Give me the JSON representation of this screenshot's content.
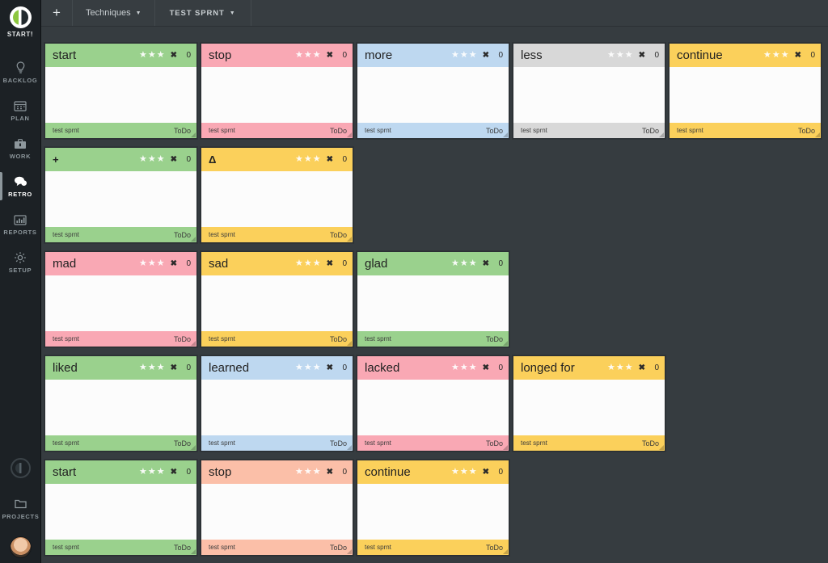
{
  "sidebar": {
    "brand": {
      "label": "START!",
      "icon": "app-logo-icon"
    },
    "items": [
      {
        "label": "BACKLOG",
        "icon": "lightbulb-icon",
        "active": false
      },
      {
        "label": "PLAN",
        "icon": "calendar-icon",
        "active": false
      },
      {
        "label": "WORK",
        "icon": "briefcase-icon",
        "active": false
      },
      {
        "label": "RETRO",
        "icon": "speech-bubble-icon",
        "active": true
      },
      {
        "label": "REPORTS",
        "icon": "bar-chart-icon",
        "active": false
      },
      {
        "label": "SETUP",
        "icon": "gear-icon",
        "active": false
      }
    ],
    "bottom": {
      "projects_label": "PROJECTS",
      "projects_icon": "folder-icon",
      "avatar": "user-avatar"
    }
  },
  "topbar": {
    "add_label": "+",
    "techniques_label": "Techniques",
    "sprint_label": "TEST SPRNT",
    "caret": "▼"
  },
  "card_defaults": {
    "stars": 3,
    "star_glyph": "★",
    "close_glyph": "✖",
    "count": "0",
    "sprint": "test sprnt",
    "status": "ToDo"
  },
  "colors": {
    "background": "#363c40",
    "sidebar": "#1c2125",
    "topbar": "#373d41",
    "green": "#9ad18d",
    "pink": "#f9a8b4",
    "blue": "#bed8f0",
    "gray": "#d8d8d8",
    "yellow": "#fbd05b",
    "salmon": "#fbbfa8",
    "accent_green": "#8cc63f"
  },
  "board": {
    "rows": [
      {
        "name": "start-stop-more-less-continue",
        "cards": [
          {
            "title": "start",
            "color": "green",
            "symbol": false
          },
          {
            "title": "stop",
            "color": "pink",
            "symbol": false
          },
          {
            "title": "more",
            "color": "blue",
            "symbol": false
          },
          {
            "title": "less",
            "color": "gray",
            "symbol": false
          },
          {
            "title": "continue",
            "color": "yellow",
            "symbol": false
          }
        ]
      },
      {
        "name": "plus-delta",
        "cards": [
          {
            "title": "+",
            "color": "green",
            "symbol": true
          },
          {
            "title": "Δ",
            "color": "yellow",
            "symbol": true
          }
        ]
      },
      {
        "name": "mad-sad-glad",
        "cards": [
          {
            "title": "mad",
            "color": "pink",
            "symbol": false
          },
          {
            "title": "sad",
            "color": "yellow",
            "symbol": false
          },
          {
            "title": "glad",
            "color": "green",
            "symbol": false
          }
        ]
      },
      {
        "name": "4l-liked-learned-lacked-longed",
        "cards": [
          {
            "title": "liked",
            "color": "green",
            "symbol": false
          },
          {
            "title": "learned",
            "color": "blue",
            "symbol": false
          },
          {
            "title": "lacked",
            "color": "pink",
            "symbol": false
          },
          {
            "title": "longed for",
            "color": "yellow",
            "symbol": false
          }
        ]
      },
      {
        "name": "start-stop-continue",
        "cards": [
          {
            "title": "start",
            "color": "green",
            "symbol": false
          },
          {
            "title": "stop",
            "color": "salmon",
            "symbol": false
          },
          {
            "title": "continue",
            "color": "yellow",
            "symbol": false
          }
        ]
      }
    ]
  }
}
